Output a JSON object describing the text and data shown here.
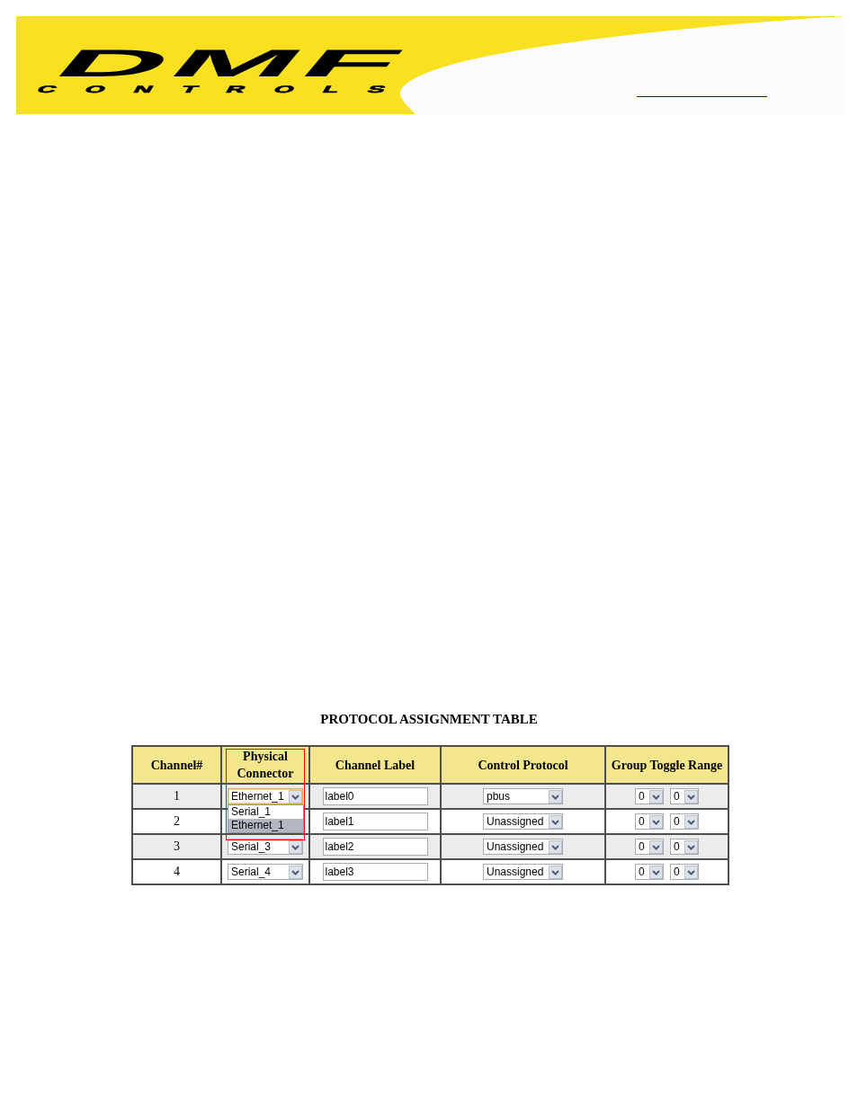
{
  "header": {
    "logo_text": "DMF",
    "logo_subtext": "CONTROLS"
  },
  "table": {
    "title": "PROTOCOL ASSIGNMENT TABLE",
    "columns": [
      {
        "label": "Channel#",
        "highlighted": false
      },
      {
        "label": "Physical Connector",
        "highlighted": true
      },
      {
        "label": "Channel Label",
        "highlighted": false
      },
      {
        "label": "Control Protocol",
        "highlighted": false
      },
      {
        "label": "Group Toggle Range",
        "highlighted": false
      }
    ],
    "rows": [
      {
        "channel": "1",
        "connector": {
          "value": "Ethernet_1",
          "focused": true,
          "open": true,
          "options": [
            {
              "label": "Serial_1",
              "selected": false
            },
            {
              "label": "Ethernet_1",
              "selected": true
            }
          ]
        },
        "label": "label0",
        "protocol": "pbus",
        "range": [
          "0",
          "0"
        ]
      },
      {
        "channel": "2",
        "label": "label1",
        "protocol": "Unassigned",
        "range": [
          "0",
          "0"
        ]
      },
      {
        "channel": "3",
        "connector": {
          "value": "Serial_3",
          "focused": false,
          "open": false
        },
        "label": "label2",
        "protocol": "Unassigned",
        "range": [
          "0",
          "0"
        ]
      },
      {
        "channel": "4",
        "connector": {
          "value": "Serial_4",
          "focused": false,
          "open": false
        },
        "label": "label3",
        "protocol": "Unassigned",
        "range": [
          "0",
          "0"
        ]
      }
    ]
  }
}
